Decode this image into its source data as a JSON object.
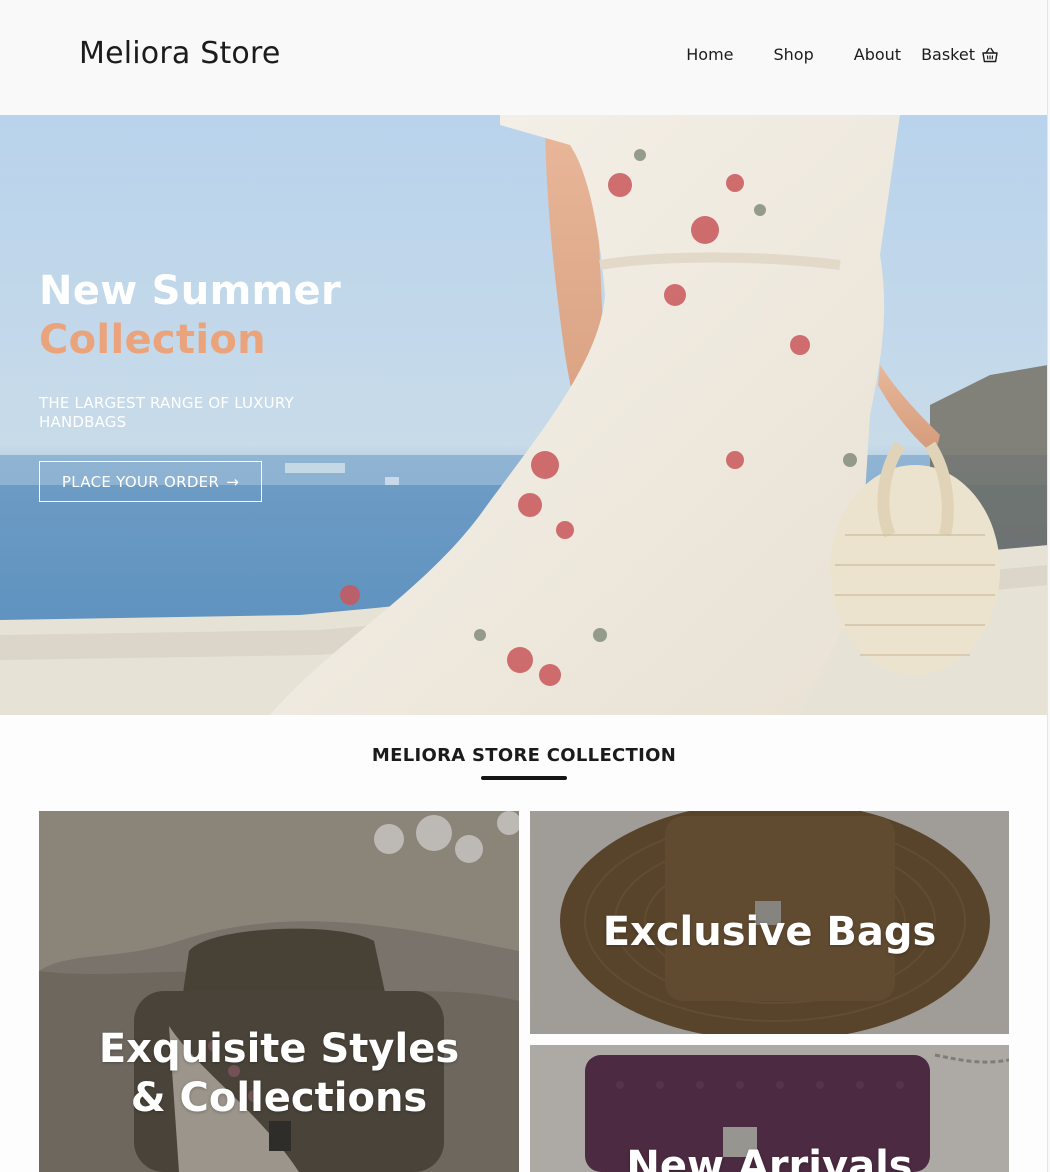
{
  "header": {
    "brand": "Meliora Store",
    "nav": [
      {
        "label": "Home"
      },
      {
        "label": "Shop"
      },
      {
        "label": "About"
      }
    ],
    "basket": {
      "label": "Basket",
      "icon": "basket-icon"
    }
  },
  "hero": {
    "title_line1": "New Summer",
    "title_line2": "Collection",
    "subtitle": "THE LARGEST RANGE OF LUXURY HANDBAGS",
    "cta_label": "PLACE YOUR ORDER",
    "cta_icon": "arrow-right-icon",
    "accent_color": "#eaa37a"
  },
  "collection": {
    "title": "MELIORA STORE COLLECTION",
    "tiles": [
      {
        "label_line1": "Exquisite Styles",
        "label_line2": "& Collections"
      },
      {
        "label_line1": "Exclusive Bags"
      },
      {
        "label_line1": "New Arrivals"
      }
    ]
  }
}
